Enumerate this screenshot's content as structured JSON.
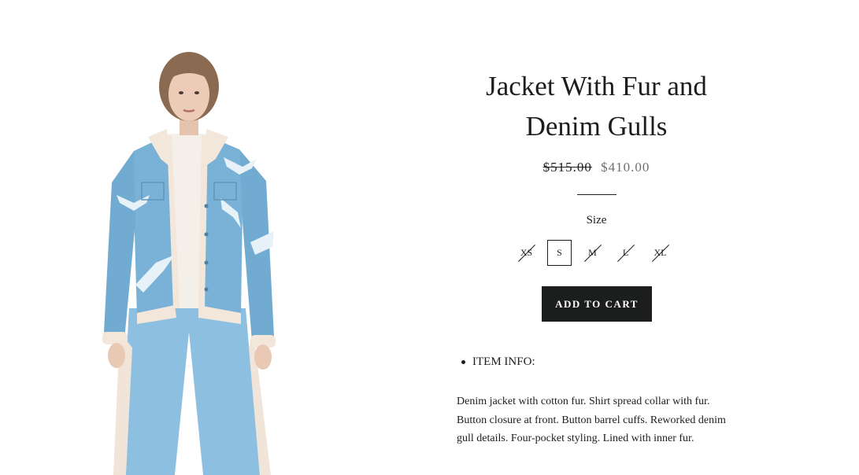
{
  "product": {
    "title": "Jacket With Fur and Denim Gulls",
    "compare_price": "$515.00",
    "sale_price": "$410.00",
    "image_icon": "model-in-denim-jacket-photo"
  },
  "size_selector": {
    "label": "Size",
    "options": [
      {
        "label": "XS",
        "sold_out": true
      },
      {
        "label": "S",
        "sold_out": false,
        "selected": true
      },
      {
        "label": "M",
        "sold_out": true
      },
      {
        "label": "L",
        "sold_out": true
      },
      {
        "label": "XL",
        "sold_out": true
      }
    ]
  },
  "cart": {
    "button_label": "ADD TO CART"
  },
  "details": {
    "item_info_heading": "ITEM INFO:",
    "description": "Denim jacket with cotton fur. Shirt spread collar with fur. Button closure at front. Button barrel cuffs. Reworked denim gull details. Four-pocket styling. Lined with inner fur."
  },
  "colors": {
    "text": "#1c1d1d",
    "sale_price": "#707070",
    "button_bg": "#1c1d1d",
    "denim": "#7fb3d5"
  }
}
